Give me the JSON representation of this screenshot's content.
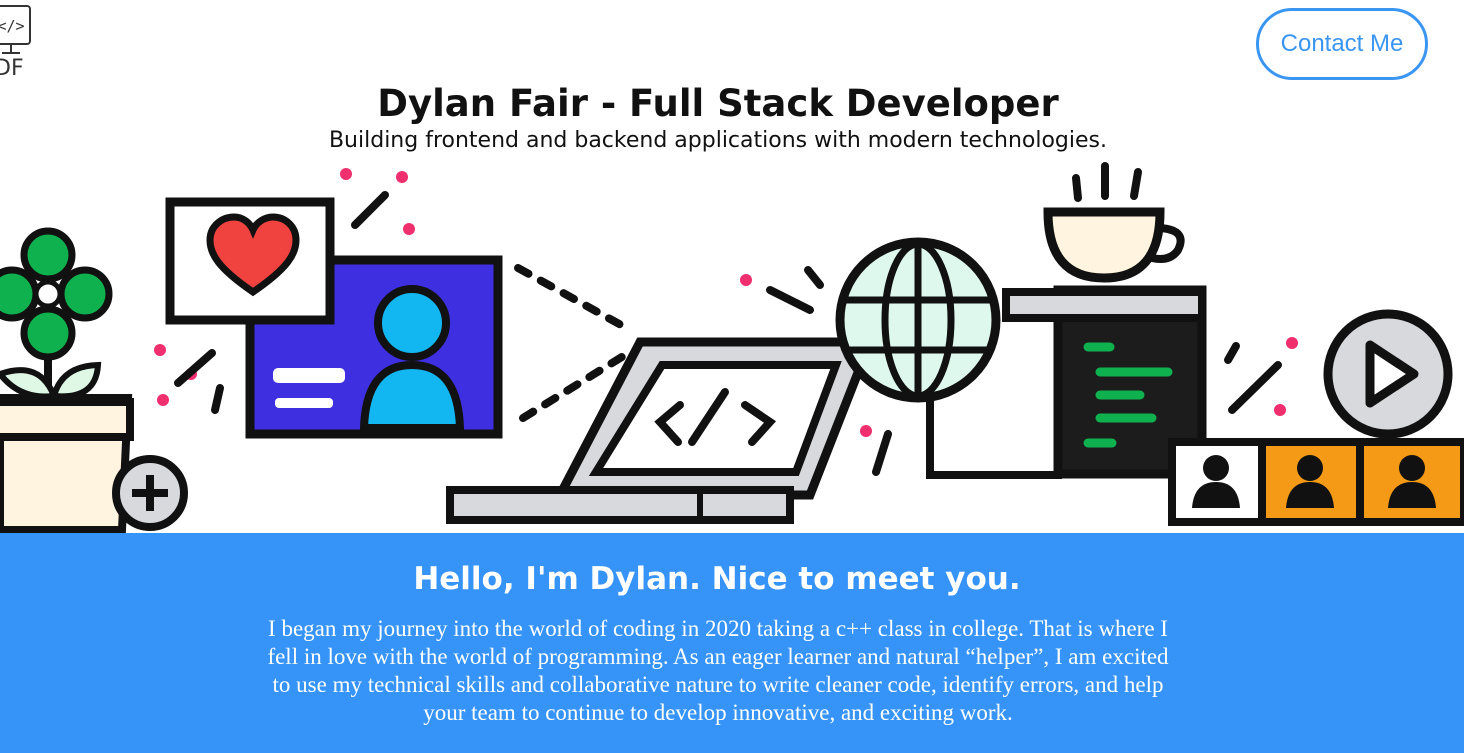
{
  "header": {
    "logo_text": "DF",
    "contact_label": "Contact Me"
  },
  "hero": {
    "title": "Dylan Fair - Full Stack Developer",
    "subtitle": "Building frontend and backend applications with modern technologies.",
    "illustration_icons": [
      "plant",
      "plus-icon",
      "heart-icon",
      "profile-card",
      "laptop-code",
      "globe-icon",
      "coffee-cup",
      "code-server",
      "play-icon",
      "user-icons"
    ],
    "colors": {
      "green": "#0fb14f",
      "red": "#f0433f",
      "blue": "#3e2fe0",
      "cyan": "#12b6f0",
      "orange": "#f59a17",
      "pink": "#ef2f6e"
    }
  },
  "about": {
    "heading": "Hello, I'm Dylan. Nice to meet you.",
    "text": "I began my journey into the world of coding in 2020 taking a c++ class in college. That is where I fell in love with the world of programming. As an eager learner and natural “helper”, I am excited to use my technical skills and collaborative nature to write cleaner code, identify errors, and help your team to continue to develop innovative, and exciting work.",
    "background": "#3694f8"
  }
}
